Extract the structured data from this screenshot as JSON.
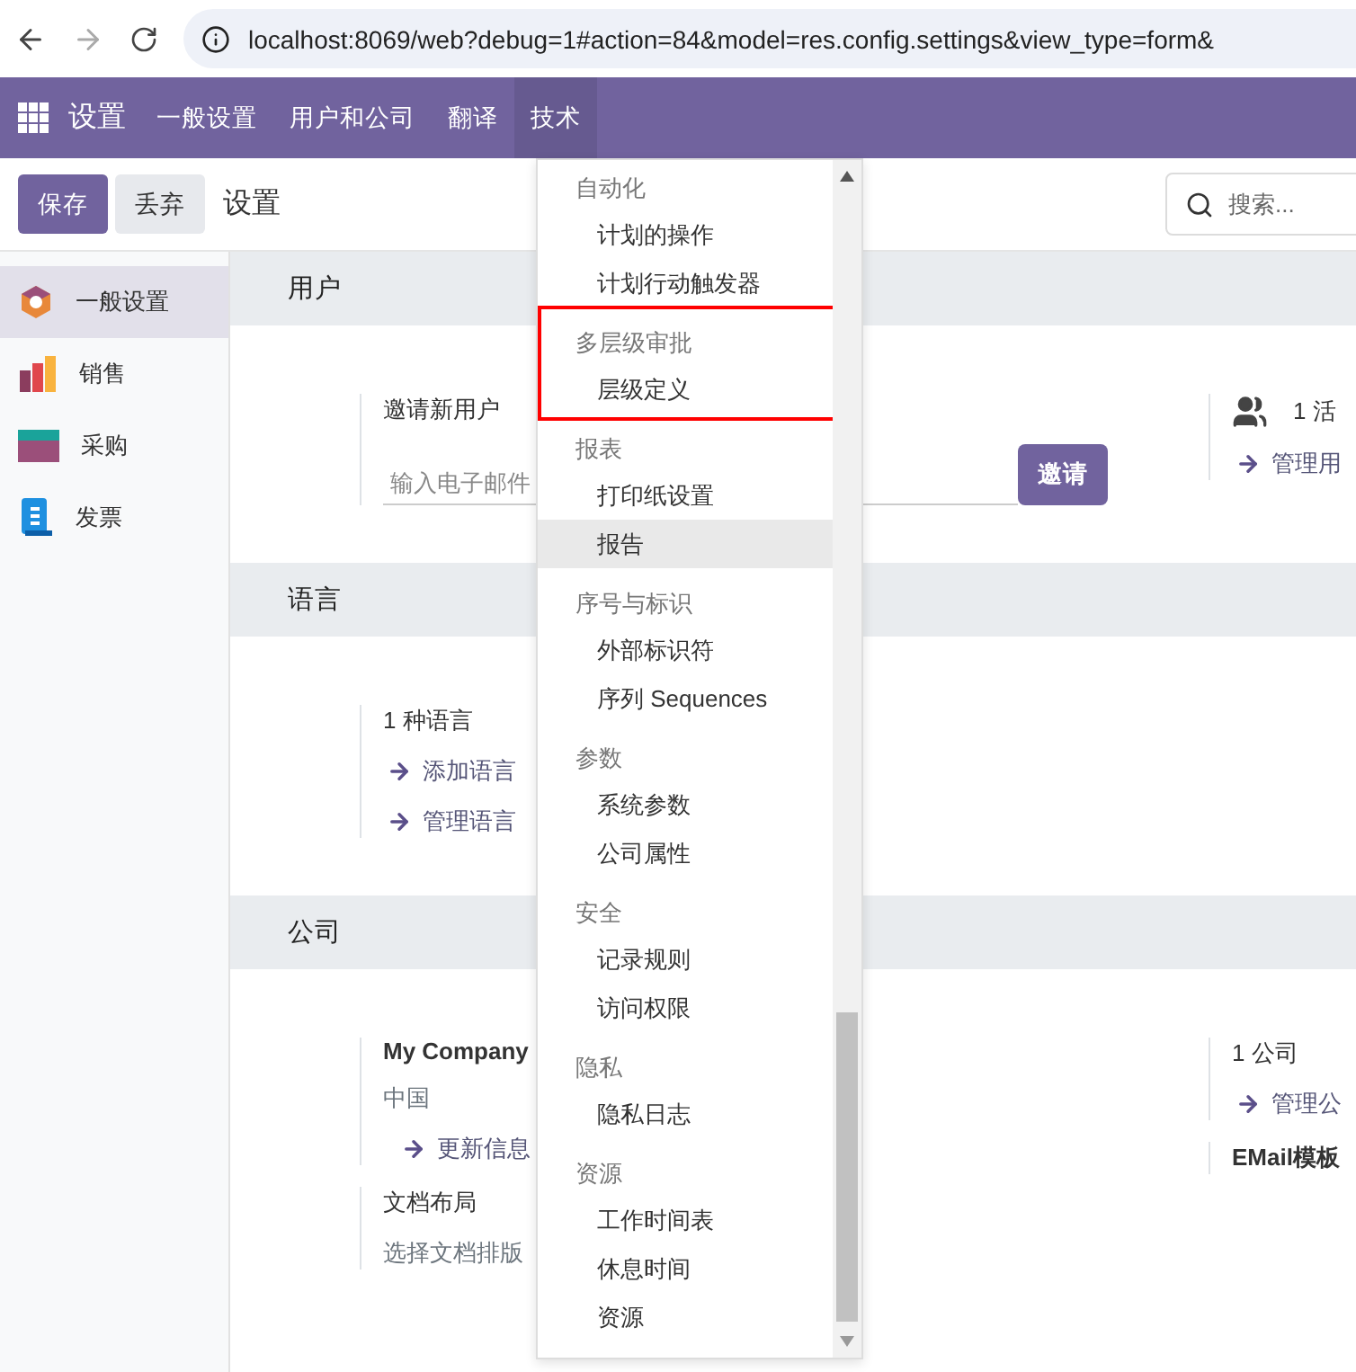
{
  "browser": {
    "url": "localhost:8069/web?debug=1#action=84&model=res.config.settings&view_type=form&"
  },
  "navbar": {
    "app_title": "设置",
    "menus": [
      {
        "label": "一般设置",
        "selected": false
      },
      {
        "label": "用户和公司",
        "selected": false
      },
      {
        "label": "翻译",
        "selected": false
      },
      {
        "label": "技术",
        "selected": true
      }
    ]
  },
  "control_panel": {
    "buttons": [
      {
        "label": "保存",
        "kind": "primary"
      },
      {
        "label": "丢弃",
        "kind": "secondary"
      }
    ],
    "breadcrumb": "设置",
    "search": {
      "placeholder": "搜索..."
    }
  },
  "sidebar": {
    "items": [
      {
        "label": "一般设置",
        "selected": true
      },
      {
        "label": "销售",
        "selected": false
      },
      {
        "label": "采购",
        "selected": false
      },
      {
        "label": "发票",
        "selected": false
      }
    ]
  },
  "sections": [
    {
      "title": "用户",
      "columns": [
        [
          {
            "items": [
              {
                "kind": "title",
                "text": "邀请新用户"
              },
              {
                "kind": "invite",
                "placeholder": "输入电子邮件",
                "button": "邀请"
              }
            ]
          }
        ],
        [
          {
            "items": [
              {
                "kind": "count",
                "text": "1 活"
              },
              {
                "kind": "link",
                "text": "管理用"
              }
            ]
          }
        ]
      ]
    },
    {
      "title": "语言",
      "columns": [
        [
          {
            "items": [
              {
                "kind": "title",
                "text": "1 种语言"
              },
              {
                "kind": "link",
                "text": "添加语言"
              },
              {
                "kind": "link",
                "text": "管理语言"
              }
            ]
          }
        ],
        []
      ]
    },
    {
      "title": "公司",
      "columns": [
        [
          {
            "items": [
              {
                "kind": "strong",
                "text": "My Company"
              },
              {
                "kind": "muted",
                "text": "中国"
              },
              {
                "kind": "link",
                "text": "更新信息"
              }
            ]
          },
          {
            "items": [
              {
                "kind": "title",
                "text": "文档布局"
              },
              {
                "kind": "muted",
                "text": "选择文档排版"
              }
            ]
          }
        ],
        [
          {
            "items": [
              {
                "kind": "title",
                "text": "1 公司"
              },
              {
                "kind": "link",
                "text": "管理公"
              }
            ]
          },
          {
            "items": [
              {
                "kind": "strong",
                "text": "EMail模板"
              }
            ]
          }
        ]
      ]
    }
  ],
  "dropdown": {
    "groups": [
      {
        "header": "自动化",
        "highlighted": false,
        "items": [
          {
            "label": "计划的操作",
            "selected": false
          },
          {
            "label": "计划行动触发器",
            "selected": false
          }
        ]
      },
      {
        "header": "多层级审批",
        "highlighted": true,
        "items": [
          {
            "label": "层级定义",
            "selected": false
          }
        ]
      },
      {
        "header": "报表",
        "highlighted": false,
        "items": [
          {
            "label": "打印纸设置",
            "selected": false
          },
          {
            "label": "报告",
            "selected": true
          }
        ]
      },
      {
        "header": "序号与标识",
        "highlighted": false,
        "items": [
          {
            "label": "外部标识符",
            "selected": false
          },
          {
            "label": "序列 Sequences",
            "selected": false
          }
        ]
      },
      {
        "header": "参数",
        "highlighted": false,
        "items": [
          {
            "label": "系统参数",
            "selected": false
          },
          {
            "label": "公司属性",
            "selected": false
          }
        ]
      },
      {
        "header": "安全",
        "highlighted": false,
        "items": [
          {
            "label": "记录规则",
            "selected": false
          },
          {
            "label": "访问权限",
            "selected": false
          }
        ]
      },
      {
        "header": "隐私",
        "highlighted": false,
        "items": [
          {
            "label": "隐私日志",
            "selected": false
          }
        ]
      },
      {
        "header": "资源",
        "highlighted": false,
        "items": [
          {
            "label": "工作时间表",
            "selected": false
          },
          {
            "label": "休息时间",
            "selected": false
          },
          {
            "label": "资源",
            "selected": false
          }
        ]
      }
    ]
  }
}
